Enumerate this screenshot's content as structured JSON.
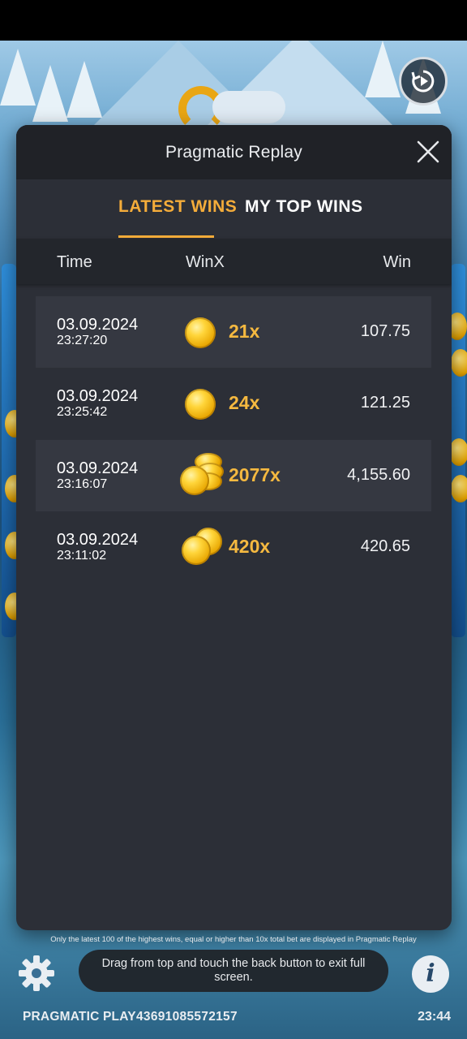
{
  "modal": {
    "title": "Pragmatic Replay",
    "tabs": [
      {
        "label": "LATEST WINS",
        "active": true
      },
      {
        "label": "MY TOP WINS",
        "active": false
      }
    ],
    "columns": {
      "time": "Time",
      "winx": "WinX",
      "win": "Win"
    },
    "rows": [
      {
        "date": "03.09.2024",
        "time": "23:27:20",
        "multiplier": "21x",
        "win": "107.75",
        "coin_icon": "single-coin-icon"
      },
      {
        "date": "03.09.2024",
        "time": "23:25:42",
        "multiplier": "24x",
        "win": "121.25",
        "coin_icon": "single-coin-icon"
      },
      {
        "date": "03.09.2024",
        "time": "23:16:07",
        "multiplier": "2077x",
        "win": "4,155.60",
        "coin_icon": "coin-stack-icon"
      },
      {
        "date": "03.09.2024",
        "time": "23:11:02",
        "multiplier": "420x",
        "win": "420.65",
        "coin_icon": "double-coin-icon"
      }
    ]
  },
  "footnote": "Only the latest 100 of the highest wins, equal or higher than 10x total bet are displayed in Pragmatic Replay",
  "toast": "Drag from top and touch the back button to exit full screen.",
  "bottom_bar": {
    "brand": "PRAGMATIC PLAY",
    "round_id": "43691085572157",
    "clock": "23:44"
  },
  "colors": {
    "accent": "#f4ac3a",
    "multiplier": "#f5b940",
    "modal_bg": "#2c2f37",
    "header_bg": "#202227"
  },
  "icons": [
    "replay-icon",
    "close-icon",
    "gear-icon",
    "info-icon",
    "coin-icon"
  ]
}
